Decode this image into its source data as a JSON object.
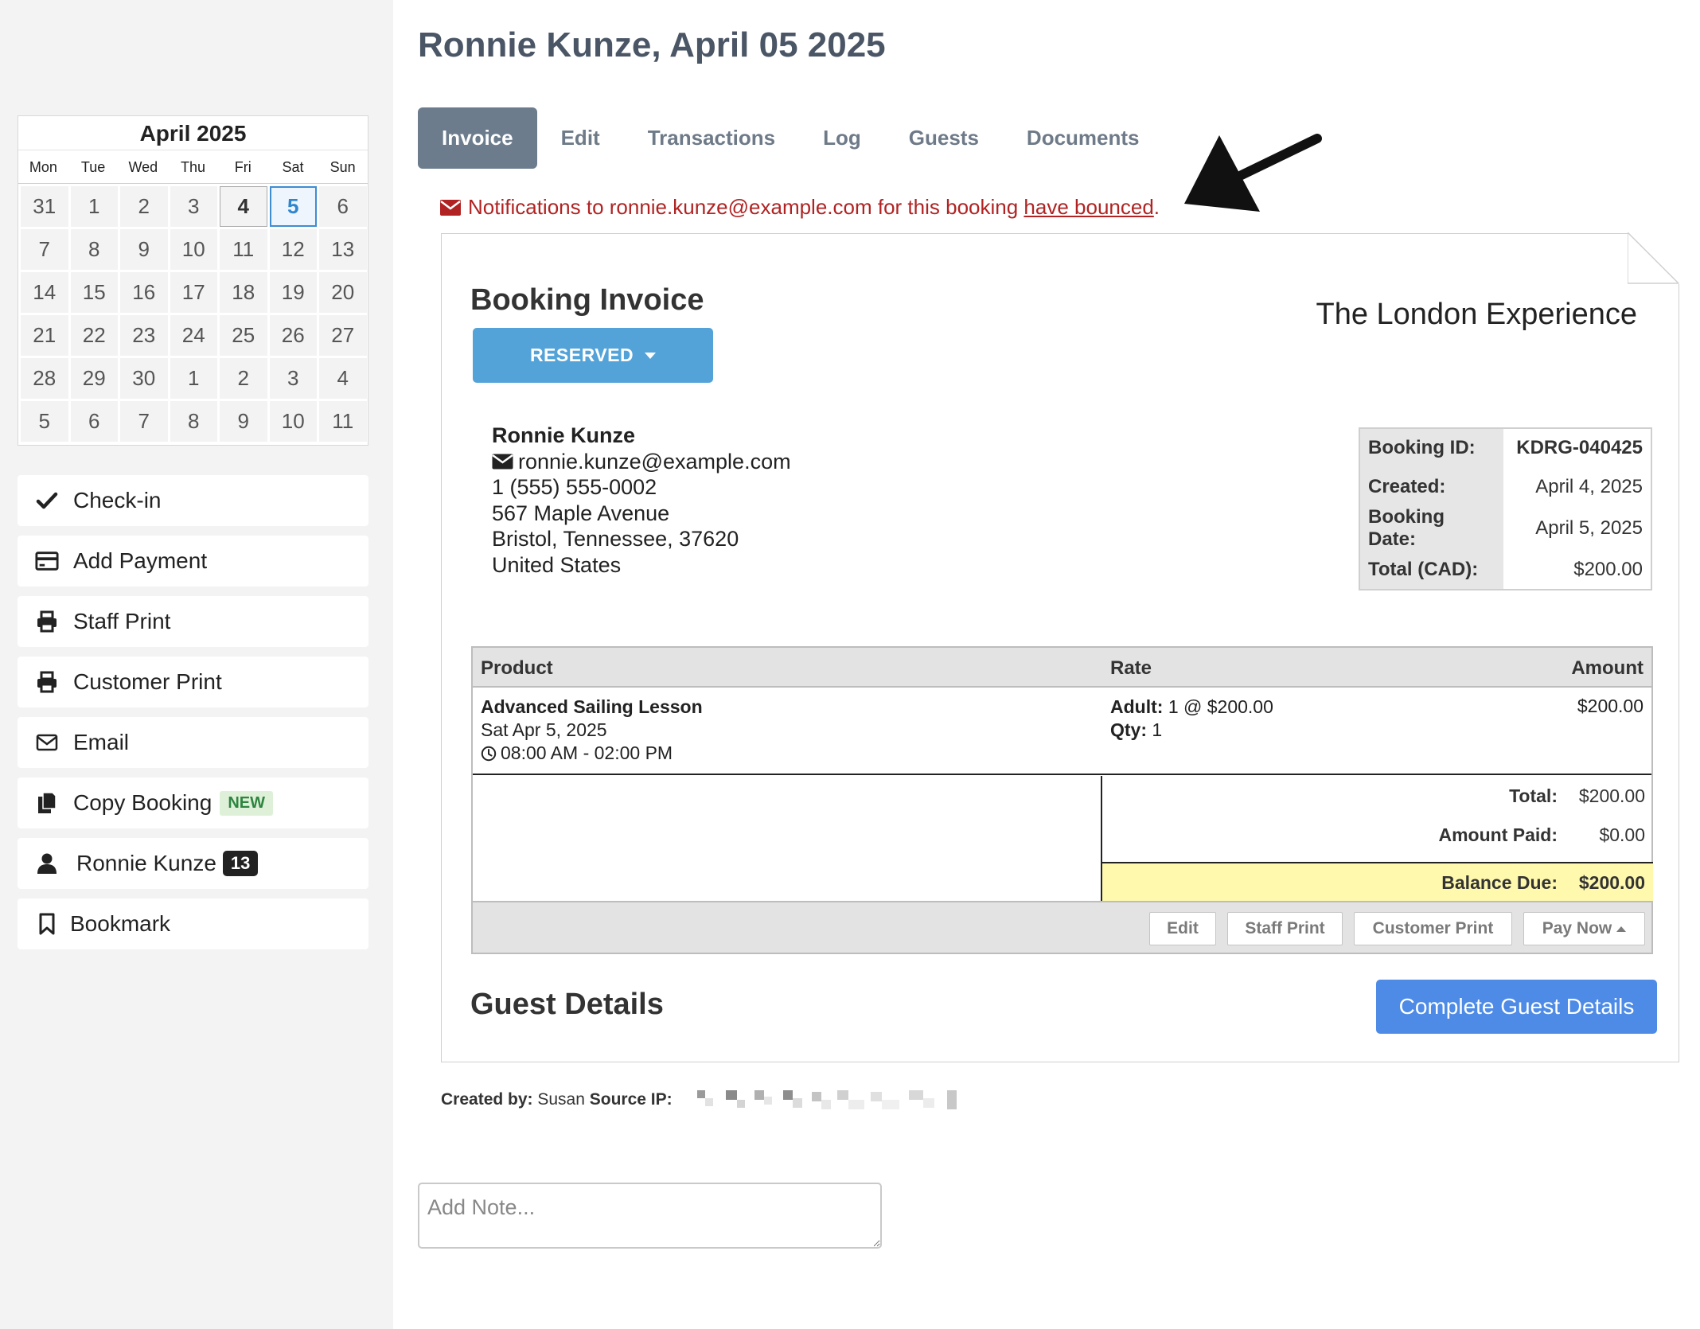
{
  "page": {
    "title": "Ronnie Kunze, April 05 2025"
  },
  "calendar": {
    "title": "April 2025",
    "weekdays": [
      "Mon",
      "Tue",
      "Wed",
      "Thu",
      "Fri",
      "Sat",
      "Sun"
    ],
    "days": [
      "31",
      "1",
      "2",
      "3",
      "4",
      "5",
      "6",
      "7",
      "8",
      "9",
      "10",
      "11",
      "12",
      "13",
      "14",
      "15",
      "16",
      "17",
      "18",
      "19",
      "20",
      "21",
      "22",
      "23",
      "24",
      "25",
      "26",
      "27",
      "28",
      "29",
      "30",
      "1",
      "2",
      "3",
      "4",
      "5",
      "6",
      "7",
      "8",
      "9",
      "10",
      "11"
    ],
    "today_index": 4,
    "selected_index": 5,
    "accent_color": "#3c8dd3"
  },
  "actions": [
    {
      "label": "Check-in",
      "icon": "check-icon"
    },
    {
      "label": "Add Payment",
      "icon": "credit-card-icon"
    },
    {
      "label": "Staff Print",
      "icon": "printer-icon"
    },
    {
      "label": "Customer Print",
      "icon": "printer-icon"
    },
    {
      "label": "Email",
      "icon": "envelope-icon"
    },
    {
      "label": "Copy Booking",
      "icon": "copy-icon",
      "badge": "NEW"
    },
    {
      "label": "Ronnie Kunze",
      "icon": "user-icon",
      "count": "13"
    },
    {
      "label": "Bookmark",
      "icon": "bookmark-icon"
    }
  ],
  "tabs": [
    {
      "label": "Invoice",
      "active": true
    },
    {
      "label": "Edit"
    },
    {
      "label": "Transactions"
    },
    {
      "label": "Log"
    },
    {
      "label": "Guests"
    },
    {
      "label": "Documents"
    }
  ],
  "alert": {
    "text_before": "Notifications to ronnie.kunze@example.com for this booking ",
    "link": "have bounced",
    "text_after": ".",
    "color": "#b12323"
  },
  "invoice": {
    "title": "Booking Invoice",
    "status": "RESERVED",
    "company": "The London Experience",
    "customer": {
      "name": "Ronnie Kunze",
      "email": "ronnie.kunze@example.com",
      "phone": "1 (555) 555-0002",
      "address1": "567 Maple Avenue",
      "address2": "Bristol, Tennessee, 37620",
      "country": "United States"
    },
    "meta": [
      {
        "label": "Booking ID:",
        "value": "KDRG-040425"
      },
      {
        "label": "Created:",
        "value": "April 4, 2025"
      },
      {
        "label": "Booking Date:",
        "value": "April 5, 2025"
      },
      {
        "label": "Total (CAD):",
        "value": "$200.00"
      }
    ],
    "table": {
      "headers": {
        "product": "Product",
        "rate": "Rate",
        "amount": "Amount"
      },
      "rows": [
        {
          "product": "Advanced Sailing Lesson",
          "date": "Sat Apr 5, 2025",
          "time": "08:00 AM - 02:00 PM",
          "rate_label": "Adult:",
          "rate_value": "1 @ $200.00",
          "qty_label": "Qty:",
          "qty_value": "1",
          "amount": "$200.00"
        }
      ],
      "totals": {
        "total_label": "Total:",
        "total_value": "$200.00",
        "paid_label": "Amount Paid:",
        "paid_value": "$0.00",
        "balance_label": "Balance Due:",
        "balance_value": "$200.00"
      },
      "footer_buttons": [
        "Edit",
        "Staff Print",
        "Customer Print",
        "Pay Now"
      ]
    },
    "guest_details": {
      "title": "Guest Details",
      "button": "Complete Guest Details"
    }
  },
  "created": {
    "by_label": "Created by:",
    "by_value": "Susan",
    "ip_label": "Source IP:"
  },
  "note": {
    "placeholder": "Add Note..."
  }
}
